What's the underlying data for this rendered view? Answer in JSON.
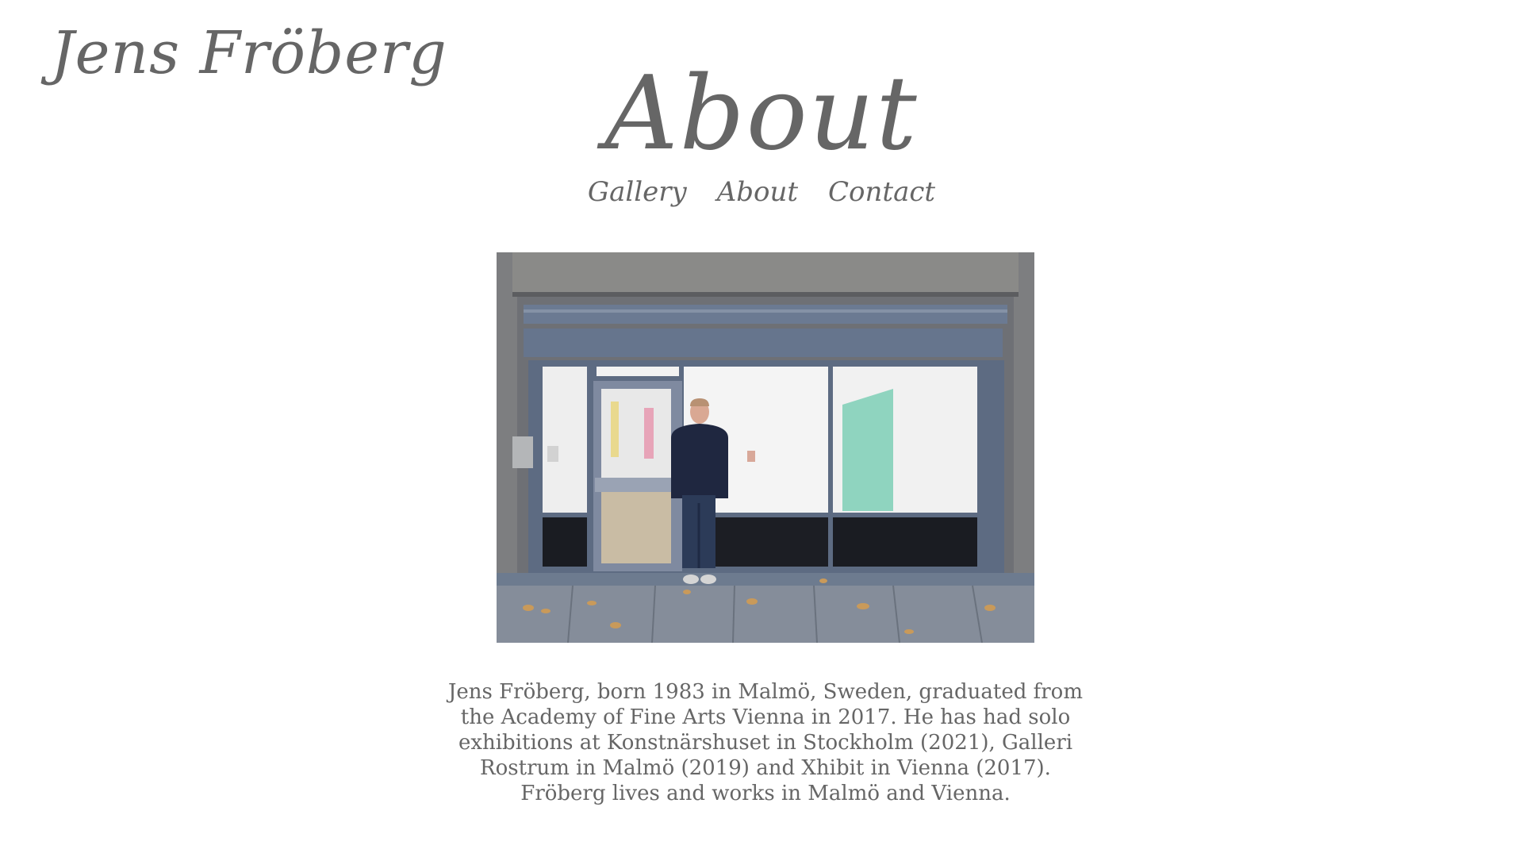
{
  "site": {
    "title": "Jens Fröberg"
  },
  "page": {
    "heading": "About"
  },
  "nav": {
    "items": [
      {
        "label": "Gallery"
      },
      {
        "label": "About"
      },
      {
        "label": "Contact"
      }
    ]
  },
  "photo": {
    "alt": "Jens Fröberg standing in front of a gallery storefront"
  },
  "bio": {
    "text": "Jens Fröberg, born 1983 in Malmö, Sweden, graduated from the Academy of Fine Arts Vienna in 2017. He has had solo exhibitions at Konstnärshuset in Stockholm (2021), Galleri Rostrum in Malmö (2019) and Xhibit in Vienna (2017). Fröberg lives and works in Malmö and Vienna."
  },
  "colors": {
    "text": "#666666",
    "background": "#ffffff"
  }
}
